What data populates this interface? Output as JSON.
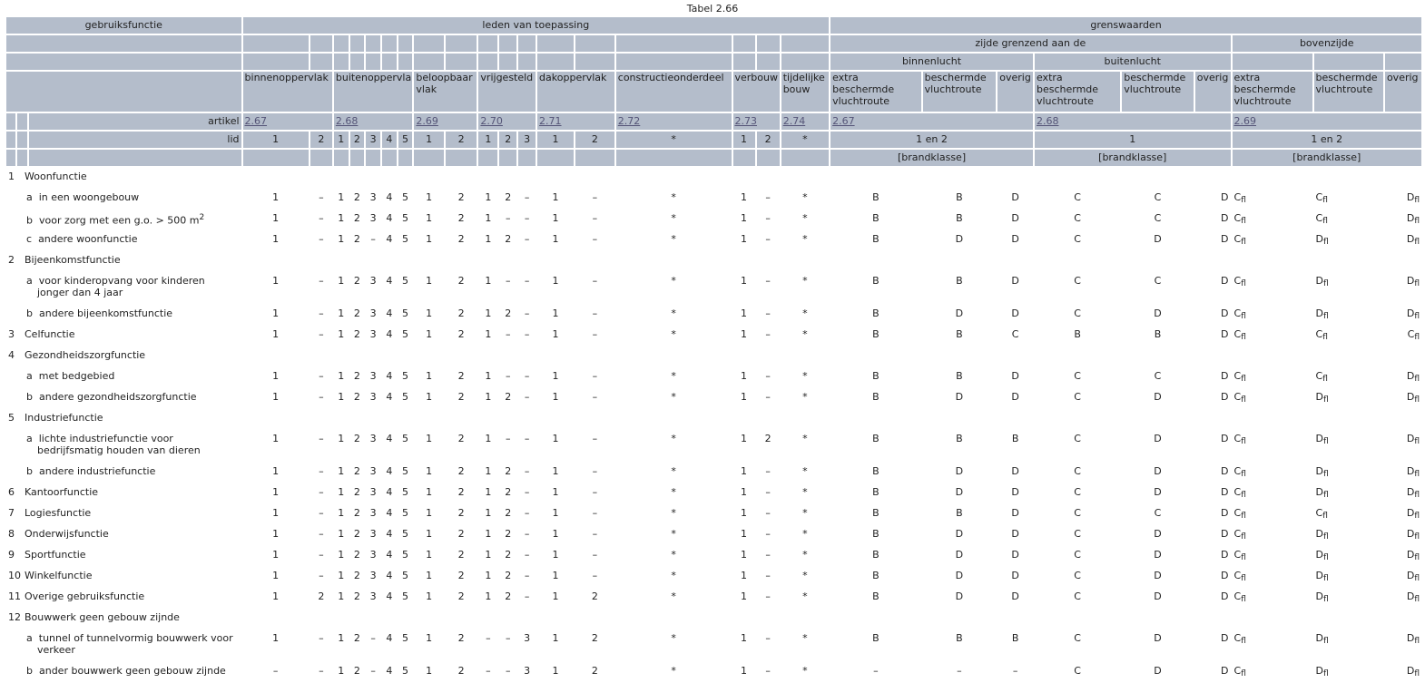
{
  "table": {
    "caption": "Tabel 2.66",
    "header": {
      "gebruiksfunctie": "gebruiksfunctie",
      "leden": "leden van toepassing",
      "grenswaarden": "grenswaarden",
      "zijde": "zijde grenzend aan de",
      "bovenzijde": "bovenzijde",
      "binnenlucht": "binnenlucht",
      "buitenlucht": "buitenlucht",
      "cols": [
        "binnenoppervlak",
        "buitenoppervlak",
        "beloopbaar vlak",
        "vrijgesteld",
        "dakoppervlak",
        "constructieonderdeel",
        "verbouw",
        "tijdelijke bouw",
        "extra beschermde vluchtroute",
        "beschermde vluchtroute",
        "overig",
        "extra beschermde vluchtroute",
        "beschermde vluchtroute",
        "overig",
        "extra beschermde vluchtroute",
        "beschermde vluchtroute",
        "overig"
      ],
      "artikel_label": "artikel",
      "artikels": [
        "2.67",
        "2.68",
        "2.69",
        "2.70",
        "2.71",
        "2.72",
        "2.73",
        "2.74",
        "2.67",
        "2.68",
        "2.69"
      ],
      "lid_label": "lid",
      "lids": [
        "1",
        "2",
        "1",
        "2",
        "3",
        "4",
        "5",
        "1",
        "2",
        "1",
        "2",
        "3",
        "1",
        "2",
        "*",
        "1",
        "2",
        "*",
        "1 en 2",
        "1",
        "1 en 2"
      ],
      "brandklasse": "[brandklasse]"
    },
    "rows": [
      {
        "kind": "group",
        "num": "1",
        "label": "Woonfunctie"
      },
      {
        "kind": "item",
        "letter": "a",
        "label": "in een woongebouw",
        "v": [
          "1",
          "–",
          "1",
          "2",
          "3",
          "4",
          "5",
          "1",
          "2",
          "1",
          "2",
          "–",
          "1",
          "–",
          "*",
          "1",
          "–",
          "*"
        ],
        "g": [
          "B",
          "B",
          "D",
          "C",
          "C",
          "D",
          "C",
          "C",
          "D"
        ]
      },
      {
        "kind": "item",
        "letter": "b",
        "label": "voor zorg met een g.o. > 500 m",
        "sup": "2",
        "v": [
          "1",
          "–",
          "1",
          "2",
          "3",
          "4",
          "5",
          "1",
          "2",
          "1",
          "–",
          "–",
          "1",
          "–",
          "*",
          "1",
          "–",
          "*"
        ],
        "g": [
          "B",
          "B",
          "D",
          "C",
          "C",
          "D",
          "C",
          "C",
          "D"
        ]
      },
      {
        "kind": "item",
        "letter": "c",
        "label": "andere woonfunctie",
        "v": [
          "1",
          "–",
          "1",
          "2",
          "–",
          "4",
          "5",
          "1",
          "2",
          "1",
          "2",
          "–",
          "1",
          "–",
          "*",
          "1",
          "–",
          "*"
        ],
        "g": [
          "B",
          "D",
          "D",
          "C",
          "D",
          "D",
          "C",
          "D",
          "D"
        ]
      },
      {
        "kind": "group",
        "num": "2",
        "label": "Bijeenkomstfunctie"
      },
      {
        "kind": "item2",
        "letter": "a",
        "label": "voor kinderopvang voor kinderen jonger dan 4 jaar",
        "v": [
          "1",
          "–",
          "1",
          "2",
          "3",
          "4",
          "5",
          "1",
          "2",
          "1",
          "–",
          "–",
          "1",
          "–",
          "*",
          "1",
          "–",
          "*"
        ],
        "g": [
          "B",
          "B",
          "D",
          "C",
          "C",
          "D",
          "C",
          "D",
          "D"
        ]
      },
      {
        "kind": "item",
        "letter": "b",
        "label": "andere bijeenkomstfunctie",
        "v": [
          "1",
          "–",
          "1",
          "2",
          "3",
          "4",
          "5",
          "1",
          "2",
          "1",
          "2",
          "–",
          "1",
          "–",
          "*",
          "1",
          "–",
          "*"
        ],
        "g": [
          "B",
          "D",
          "D",
          "C",
          "D",
          "D",
          "C",
          "D",
          "D"
        ]
      },
      {
        "kind": "group-data",
        "num": "3",
        "label": "Celfunctie",
        "v": [
          "1",
          "–",
          "1",
          "2",
          "3",
          "4",
          "5",
          "1",
          "2",
          "1",
          "–",
          "–",
          "1",
          "–",
          "*",
          "1",
          "–",
          "*"
        ],
        "g": [
          "B",
          "B",
          "C",
          "B",
          "B",
          "D",
          "C",
          "C",
          "C"
        ]
      },
      {
        "kind": "group",
        "num": "4",
        "label": "Gezondheidszorgfunctie"
      },
      {
        "kind": "item",
        "letter": "a",
        "label": "met bedgebied",
        "v": [
          "1",
          "–",
          "1",
          "2",
          "3",
          "4",
          "5",
          "1",
          "2",
          "1",
          "–",
          "–",
          "1",
          "–",
          "*",
          "1",
          "–",
          "*"
        ],
        "g": [
          "B",
          "B",
          "D",
          "C",
          "C",
          "D",
          "C",
          "C",
          "D"
        ]
      },
      {
        "kind": "item",
        "letter": "b",
        "label": "andere gezondheidszorgfunctie",
        "v": [
          "1",
          "–",
          "1",
          "2",
          "3",
          "4",
          "5",
          "1",
          "2",
          "1",
          "2",
          "–",
          "1",
          "–",
          "*",
          "1",
          "–",
          "*"
        ],
        "g": [
          "B",
          "D",
          "D",
          "C",
          "D",
          "D",
          "C",
          "D",
          "D"
        ]
      },
      {
        "kind": "group",
        "num": "5",
        "label": "Industriefunctie"
      },
      {
        "kind": "item2",
        "letter": "a",
        "label": "lichte industriefunctie voor bedrijfsmatig houden van dieren",
        "v": [
          "1",
          "–",
          "1",
          "2",
          "3",
          "4",
          "5",
          "1",
          "2",
          "1",
          "–",
          "–",
          "1",
          "–",
          "*",
          "1",
          "2",
          "*"
        ],
        "g": [
          "B",
          "B",
          "B",
          "C",
          "D",
          "D",
          "C",
          "D",
          "D"
        ]
      },
      {
        "kind": "item",
        "letter": "b",
        "label": "andere industriefunctie",
        "v": [
          "1",
          "–",
          "1",
          "2",
          "3",
          "4",
          "5",
          "1",
          "2",
          "1",
          "2",
          "–",
          "1",
          "–",
          "*",
          "1",
          "–",
          "*"
        ],
        "g": [
          "B",
          "D",
          "D",
          "C",
          "D",
          "D",
          "C",
          "D",
          "D"
        ]
      },
      {
        "kind": "group-data",
        "num": "6",
        "label": "Kantoorfunctie",
        "v": [
          "1",
          "–",
          "1",
          "2",
          "3",
          "4",
          "5",
          "1",
          "2",
          "1",
          "2",
          "–",
          "1",
          "–",
          "*",
          "1",
          "–",
          "*"
        ],
        "g": [
          "B",
          "D",
          "D",
          "C",
          "D",
          "D",
          "C",
          "D",
          "D"
        ]
      },
      {
        "kind": "group-data",
        "num": "7",
        "label": "Logiesfunctie",
        "v": [
          "1",
          "–",
          "1",
          "2",
          "3",
          "4",
          "5",
          "1",
          "2",
          "1",
          "2",
          "–",
          "1",
          "–",
          "*",
          "1",
          "–",
          "*"
        ],
        "g": [
          "B",
          "B",
          "D",
          "C",
          "C",
          "D",
          "C",
          "C",
          "D"
        ]
      },
      {
        "kind": "group-data",
        "num": "8",
        "label": "Onderwijsfunctie",
        "v": [
          "1",
          "–",
          "1",
          "2",
          "3",
          "4",
          "5",
          "1",
          "2",
          "1",
          "2",
          "–",
          "1",
          "–",
          "*",
          "1",
          "–",
          "*"
        ],
        "g": [
          "B",
          "D",
          "D",
          "C",
          "D",
          "D",
          "C",
          "D",
          "D"
        ]
      },
      {
        "kind": "group-data",
        "num": "9",
        "label": "Sportfunctie",
        "v": [
          "1",
          "–",
          "1",
          "2",
          "3",
          "4",
          "5",
          "1",
          "2",
          "1",
          "2",
          "–",
          "1",
          "–",
          "*",
          "1",
          "–",
          "*"
        ],
        "g": [
          "B",
          "D",
          "D",
          "C",
          "D",
          "D",
          "C",
          "D",
          "D"
        ]
      },
      {
        "kind": "group-data",
        "num": "10",
        "label": "Winkelfunctie",
        "v": [
          "1",
          "–",
          "1",
          "2",
          "3",
          "4",
          "5",
          "1",
          "2",
          "1",
          "2",
          "–",
          "1",
          "–",
          "*",
          "1",
          "–",
          "*"
        ],
        "g": [
          "B",
          "D",
          "D",
          "C",
          "D",
          "D",
          "C",
          "D",
          "D"
        ]
      },
      {
        "kind": "group-data",
        "num": "11",
        "label": "Overige gebruiksfunctie",
        "v": [
          "1",
          "2",
          "1",
          "2",
          "3",
          "4",
          "5",
          "1",
          "2",
          "1",
          "2",
          "–",
          "1",
          "2",
          "*",
          "1",
          "–",
          "*"
        ],
        "g": [
          "B",
          "D",
          "D",
          "C",
          "D",
          "D",
          "C",
          "D",
          "D"
        ]
      },
      {
        "kind": "group",
        "num": "12",
        "label": "Bouwwerk geen gebouw zijnde"
      },
      {
        "kind": "item2",
        "letter": "a",
        "label": "tunnel of tunnelvormig bouwwerk voor verkeer",
        "v": [
          "1",
          "–",
          "1",
          "2",
          "–",
          "4",
          "5",
          "1",
          "2",
          "–",
          "–",
          "3",
          "1",
          "2",
          "*",
          "1",
          "–",
          "*"
        ],
        "g": [
          "B",
          "B",
          "B",
          "C",
          "D",
          "D",
          "C",
          "D",
          "D"
        ]
      },
      {
        "kind": "item",
        "letter": "b",
        "label": "ander bouwwerk geen gebouw zijnde",
        "v": [
          "–",
          "–",
          "1",
          "2",
          "–",
          "4",
          "5",
          "1",
          "2",
          "–",
          "–",
          "3",
          "1",
          "2",
          "*",
          "1",
          "–",
          "*"
        ],
        "g": [
          "–",
          "–",
          "–",
          "C",
          "D",
          "D",
          "C",
          "D",
          "D"
        ]
      }
    ],
    "fl_subscript": "fl"
  }
}
